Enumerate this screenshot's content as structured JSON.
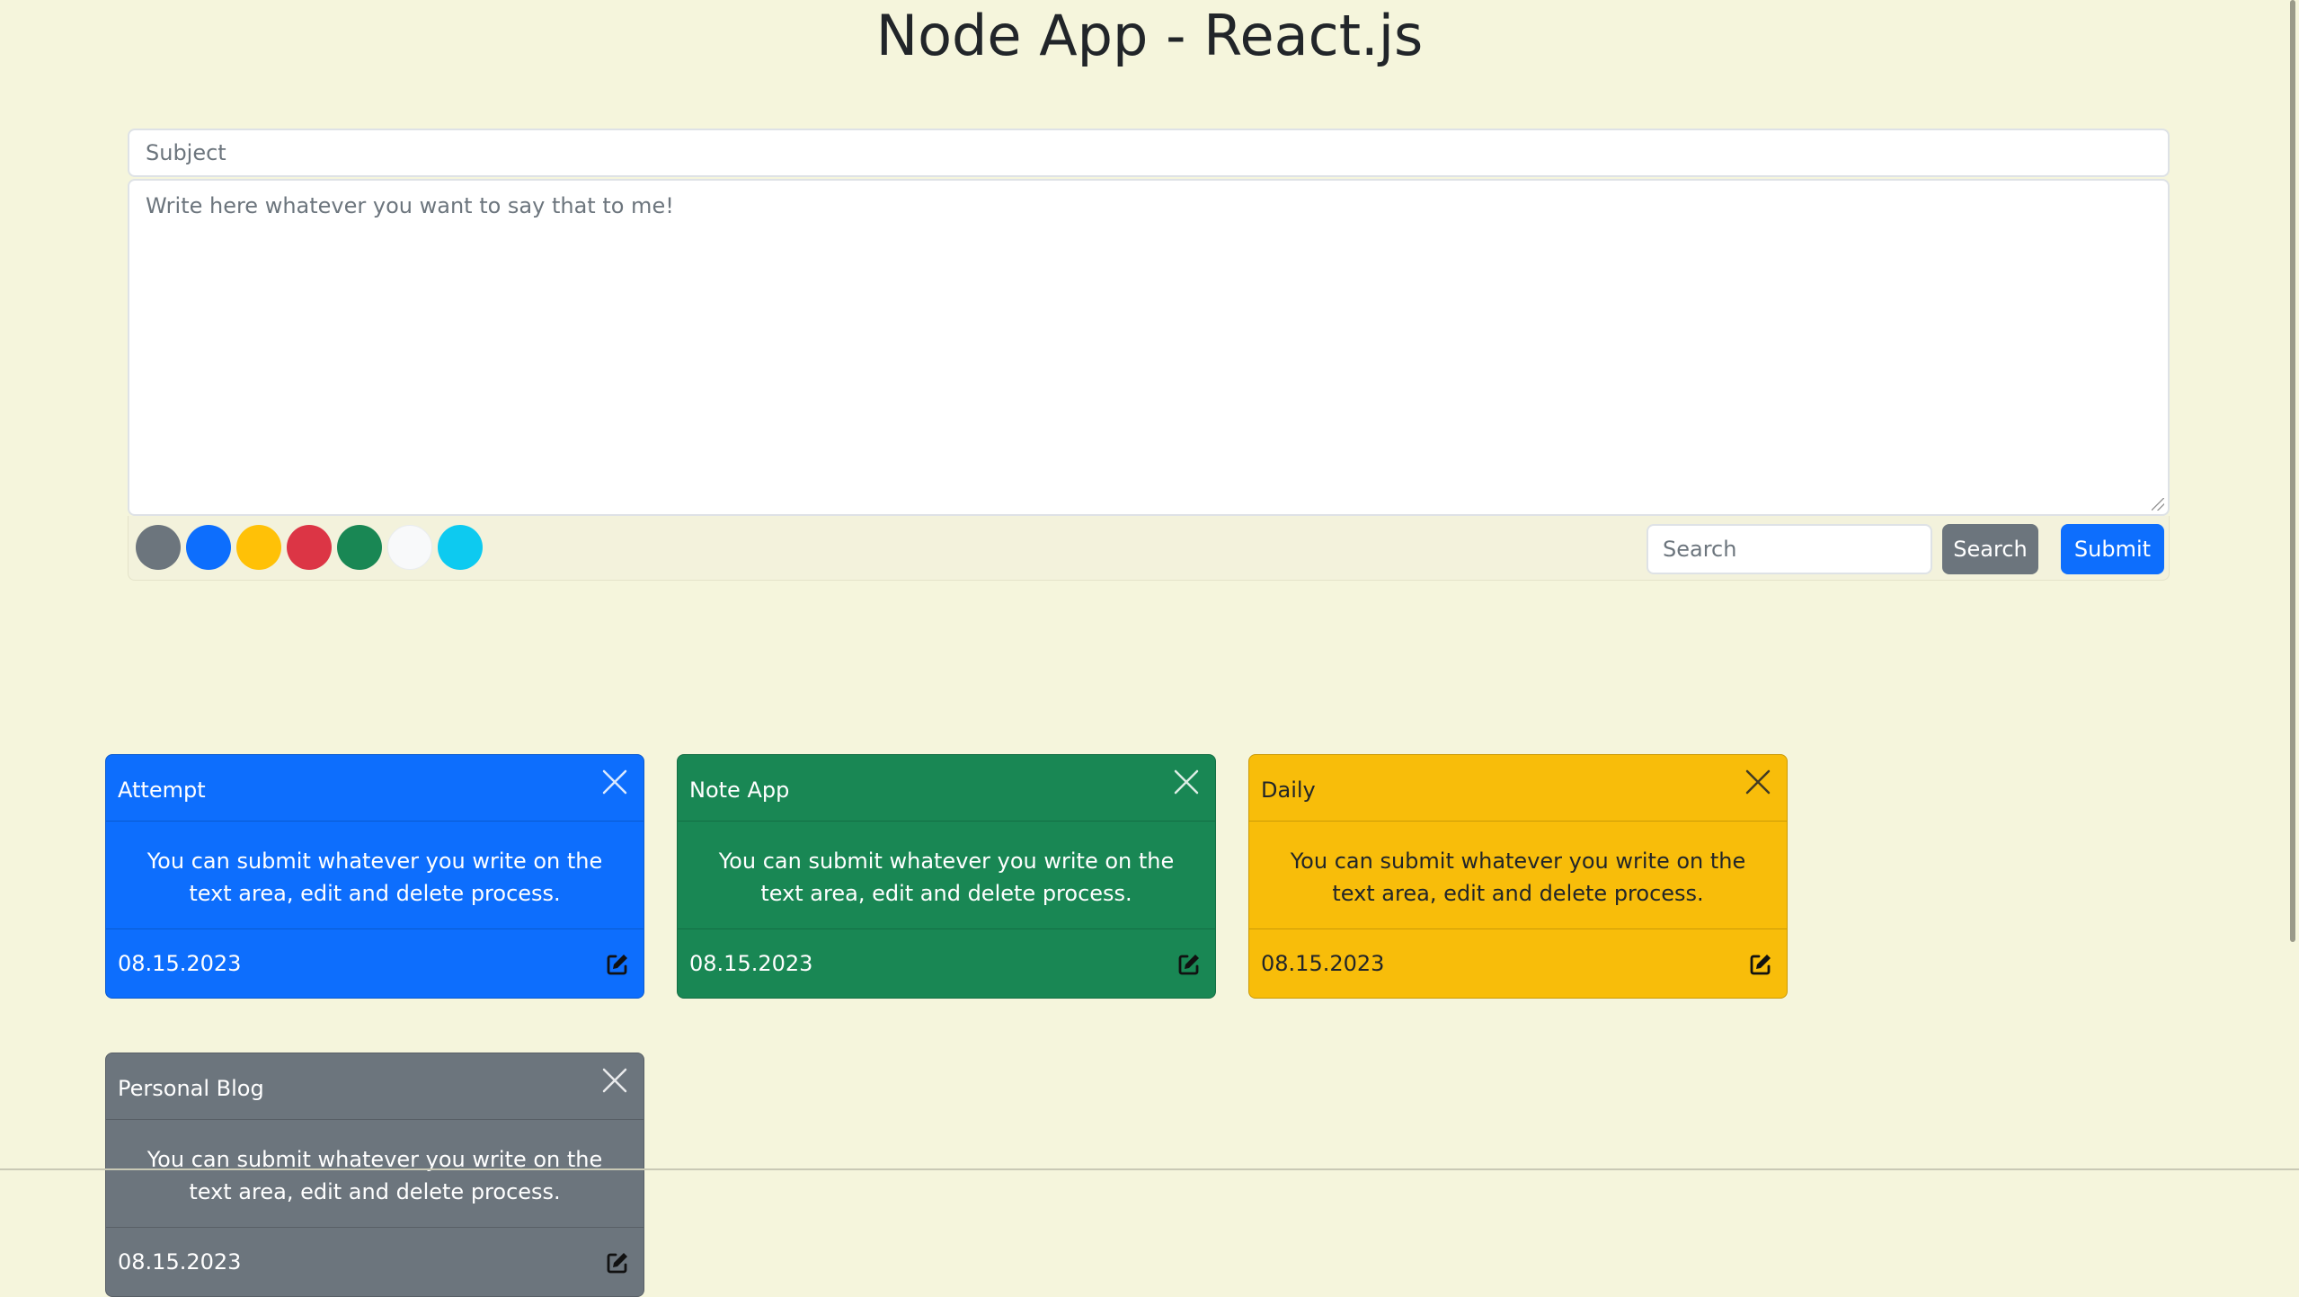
{
  "header": {
    "title": "Node App - React.js"
  },
  "form": {
    "subject_placeholder": "Subject",
    "body_placeholder": "Write here whatever you want to say that to me!",
    "colors": [
      {
        "name": "secondary",
        "hex": "#6c757d"
      },
      {
        "name": "primary",
        "hex": "#0d6efd"
      },
      {
        "name": "warning",
        "hex": "#ffc107"
      },
      {
        "name": "danger",
        "hex": "#dc3545"
      },
      {
        "name": "success",
        "hex": "#198754"
      },
      {
        "name": "light",
        "hex": "#f8f9fa"
      },
      {
        "name": "info",
        "hex": "#0dcaf0"
      }
    ],
    "search_placeholder": "Search",
    "search_button": "Search",
    "submit_button": "Submit"
  },
  "notes": [
    {
      "title": "Attempt",
      "body": "You can submit whatever you write on the text area, edit and delete process.",
      "date": "08.15.2023",
      "color": "#0d6efd",
      "text_color": "#ffffff"
    },
    {
      "title": "Note App",
      "body": "You can submit whatever you write on the text area, edit and delete process.",
      "date": "08.15.2023",
      "color": "#198754",
      "text_color": "#ffffff"
    },
    {
      "title": "Daily",
      "body": "You can submit whatever you write on the text area, edit and delete process.",
      "date": "08.15.2023",
      "color": "#f8bd0a",
      "text_color": "#212529"
    },
    {
      "title": "Personal Blog",
      "body": "You can submit whatever you write on the text area, edit and delete process.",
      "date": "08.15.2023",
      "color": "#6c757d",
      "text_color": "#ffffff"
    }
  ],
  "icons": {
    "close": "close-icon",
    "edit": "edit-icon"
  }
}
